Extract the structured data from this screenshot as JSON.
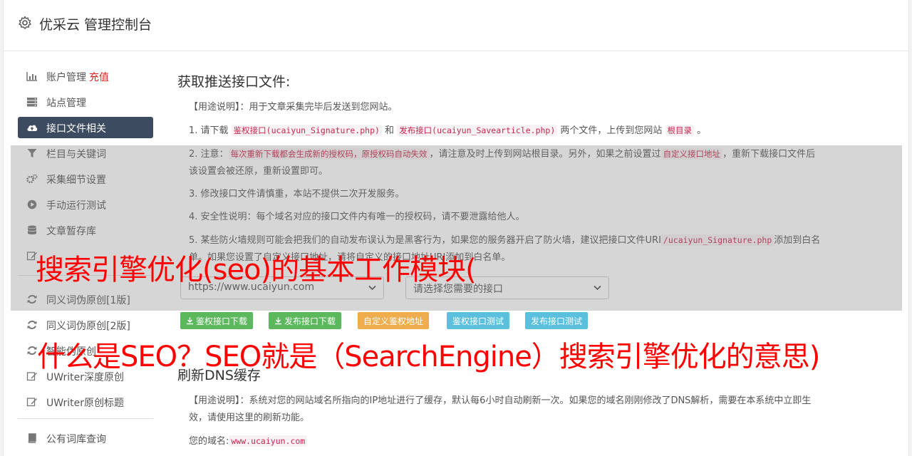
{
  "header": {
    "title": "优采云 管理控制台",
    "icon": "gear-icon"
  },
  "sidebar": {
    "items": [
      {
        "label": "账户管理",
        "extra": "充值",
        "icon": "bar-chart-icon"
      },
      {
        "label": "站点管理",
        "icon": "server-icon"
      },
      {
        "label": "接口文件相关",
        "icon": "cloud-upload-icon",
        "active": true
      },
      {
        "label": "栏目与关键词",
        "icon": "filter-icon"
      },
      {
        "label": "采集细节设置",
        "icon": "cogs-icon"
      },
      {
        "label": "手动运行测试",
        "icon": "play-circle-icon"
      },
      {
        "label": "文章暂存库",
        "icon": "database-icon"
      },
      {
        "label": "",
        "icon": "edit-icon"
      },
      {
        "label": "同义词伪原创[1版]",
        "icon": "refresh-icon"
      },
      {
        "label": "同义词伪原创[2版]",
        "icon": "refresh-icon"
      },
      {
        "label": "智能伪原创",
        "icon": "refresh-icon"
      },
      {
        "label": "UWriter深度原创",
        "icon": "edit-icon"
      },
      {
        "label": "UWriter原创标题",
        "icon": "edit-icon"
      },
      {
        "label": "公有词库查询",
        "icon": "book-icon"
      }
    ]
  },
  "main": {
    "section1": {
      "title": "获取推送接口文件:",
      "usage": "【用途说明】：用于文章采集完毕后发送到您网站。",
      "step1": {
        "a": "1. 请下载 ",
        "c1": "鉴权接口(ucaiyun_Signature.php)",
        "b": " 和 ",
        "c2": "发布接口(ucaiyun_Savearticle.php)",
        "d": " 两个文件，上传到您网站 ",
        "c3": "根目录",
        "e": " 。"
      },
      "step2": {
        "a": "2. 注意：",
        "c1": "每次重新下载都会生成新的授权码，原授权码自动失效",
        "b": "，请注意及时上传到网站根目录。另外，如果之前设置过",
        "c2": "自定义接口地址",
        "d": "，重新下载接口文件后该设置会被还原，重新设置即可。"
      },
      "step3": "3. 修改接口文件请慎重，本站不提供二次开发服务。",
      "step4": "4. 安全性说明：每个域名对应的接口文件内有唯一的授权码，请不要泄露给他人。",
      "step5": {
        "a": "5. 某些防火墙规则可能会把我们的自动发布误认为是黑客行为，如果您的服务器开启了防火墙，建议把接口文件URI",
        "c1": "/ucaiyun_Signature.php",
        "b": "添加到白名单。如果您设置了自定义接口地址，请将自定义的接口地址URI添加到白名单。"
      },
      "domain_select": "https://www.ucaiyun.com",
      "api_select": "请选择您需要的接口",
      "buttons": {
        "b1": "鉴权接口下载",
        "b1_color": "#5cb85c",
        "b2": "发布接口下载",
        "b2_color": "#5cb85c",
        "b3": "自定义鉴权地址",
        "b3_color": "#f0ad4e",
        "b4": "鉴权接口测试",
        "b4_color": "#5bc0de",
        "b5": "发布接口测试",
        "b5_color": "#5bc0de"
      }
    },
    "section2": {
      "title": "刷新DNS缓存",
      "usage": "【用途说明】：系统对您的网站域名所指向的IP地址进行了缓存，默认每6小时自动刷新一次。如果您的域名刚刚修改了DNS解析，需要在本系统中立即生效，请使用这里的刷新功能。",
      "domain_label": "您的域名:",
      "domain_value": "www.ucaiyun.com"
    }
  },
  "overlay": {
    "line1": "搜索引擎优化(seo)的基本工作模块(",
    "line2": "什么是SEO？SEO就是（SearchEngine）搜索引擎优化的意思)",
    "color": "#ff0000"
  }
}
